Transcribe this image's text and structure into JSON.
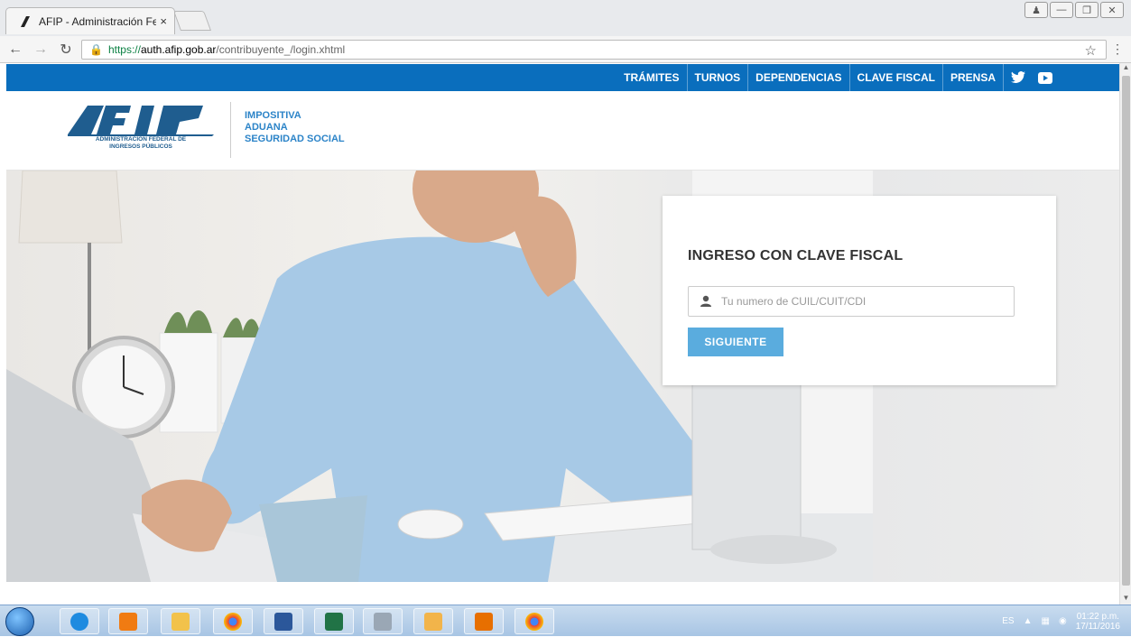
{
  "browser": {
    "tab_title": "AFIP - Administración Fe",
    "tab_close": "×",
    "url_scheme": "https://",
    "url_host": "auth.afip.gob.ar",
    "url_path": "/contribuyente_/login.xhtml"
  },
  "topnav": {
    "items": [
      "TRÁMITES",
      "TURNOS",
      "DEPENDENCIAS",
      "CLAVE FISCAL",
      "PRENSA"
    ]
  },
  "header": {
    "logo_caption_line1": "ADMINISTRACIÓN FEDERAL DE",
    "logo_caption_line2": "INGRESOS PÚBLICOS",
    "tagline1": "IMPOSITIVA",
    "tagline2": "ADUANA",
    "tagline3": "SEGURIDAD SOCIAL"
  },
  "login": {
    "title": "INGRESO CON CLAVE FISCAL",
    "input_placeholder": "Tu numero de CUIL/CUIT/CDI",
    "button_label": "SIGUIENTE"
  },
  "taskbar": {
    "language": "ES",
    "time": "01:22 p.m.",
    "date": "17/11/2016"
  },
  "colors": {
    "brand_blue": "#0a6ebd",
    "accent_blue": "#2c84c8",
    "button_blue": "#5aacde"
  }
}
